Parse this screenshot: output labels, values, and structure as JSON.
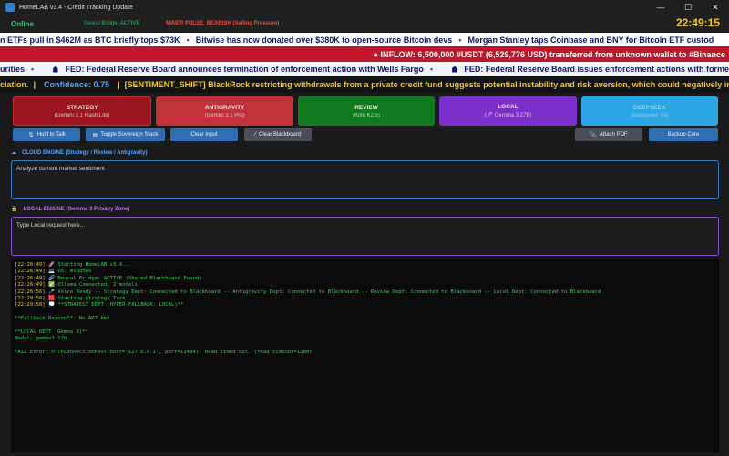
{
  "window": {
    "title": "HomeLAB v3.4 - Credit Tracking Update",
    "controls": {
      "minimize": "—",
      "maximize": "☐",
      "close": "✕"
    }
  },
  "status": {
    "online": "Online",
    "bridge": "Neural Bridge: ACTIVE",
    "pulse": "MINER PULSE: BEARISH (Selling Pressure)",
    "clock": "22:49:15"
  },
  "tickers": {
    "news": [
      "n ETFs pull in $462M as BTC briefly tops $73K",
      "Bitwise has now donated over $380K to open-source Bitcoin devs",
      "Morgan Stanley taps Coinbase and BNY for Bitcoin ETF custod"
    ],
    "whale": "● INFLOW: 6,500,000 #USDT (6,529,776 USD) transferred from unknown wallet to #Binance",
    "fed": [
      "urities",
      "FED: Federal Reserve Board announces termination of enforcement action with Wells Fargo",
      "FED: Federal Reserve Board issues enforcement actions with forme"
    ],
    "sentiment": {
      "tail": "ciation.",
      "confidence": "Confidence: 0.75",
      "shift": "[SENTIMENT_SHIFT] BlackRock restricting withdrawals from a private credit fund suggests potential instability and risk aversion, which could negatively im"
    }
  },
  "models": [
    {
      "name": "STRATEGY",
      "sub": "(Gemini 3.1 Flash Lite)"
    },
    {
      "name": "ANTIGRAVITY",
      "sub": "(Gemini 3.1 Pro)"
    },
    {
      "name": "REVIEW",
      "sub": "(Kimi K2.5)"
    },
    {
      "name": "LOCAL",
      "sub": "(🖋 Gemma 3 27B)"
    },
    {
      "name": "DEEPSEEK",
      "sub": "(DeepSeek V3)"
    }
  ],
  "toolbar": {
    "hold_to_talk": "Hold to Talk",
    "toggle_stack": "Toggle Sovereign Stack",
    "clear_input": "Clear Input",
    "clear_blackboard": "Clear Blackboard",
    "attach_pdf": "Attach PDF",
    "backup_core": "Backup Core"
  },
  "cloud": {
    "label": "CLOUD ENGINE (Strategy / Review / Antigravity)",
    "value": "Analyze current market sentiment"
  },
  "local": {
    "label": "LOCAL ENGINE (Gemma 3 Privacy Zone)",
    "placeholder": "Type Local request here..."
  },
  "log": [
    {
      "ts": "[22:26:49]",
      "text": " 🚀 Starting HomeLAB v3.4..."
    },
    {
      "ts": "[22:26:49]",
      "text": " 💻 OS: Windows"
    },
    {
      "ts": "[22:26:49]",
      "text": " 🔗 Neural Bridge: ACTIVE (Shared Blackboard Found)"
    },
    {
      "ts": "[22:26:49]",
      "text": " ✅ Ollama Connected: 2 models"
    },
    {
      "ts": "[22:26:56]",
      "text": " 🎤 Voice Ready -- Strategy Dept: Connected to Blackboard -- Antigravity Dept: Connected to Blackboard -- Review Dept: Connected to Blackboard -- Local Dept: Connected to Blackboard"
    },
    {
      "ts": "[22:29:56]",
      "text": " 🟥 Starting Strategy Task..."
    },
    {
      "ts": "[22:29:56]",
      "text": " 💭 **STRATEGY DEPT (HYPER-FALLBACK: LOCAL)**"
    },
    {
      "ts": "",
      "text": ""
    },
    {
      "ts": "",
      "text": "**Fallback Reason**: No API key"
    },
    {
      "ts": "",
      "text": ""
    },
    {
      "ts": "",
      "text": "**LOCAL DEPT (Gemma 3)**"
    },
    {
      "ts": "",
      "text": "Model: gemma3:12b"
    },
    {
      "ts": "",
      "text": ""
    },
    {
      "ts": "",
      "text": "FAIL Error: HTTPConnectionPool(host='127.0.0.1', port=11434): Read timed out. (read timeout=1200)"
    }
  ]
}
